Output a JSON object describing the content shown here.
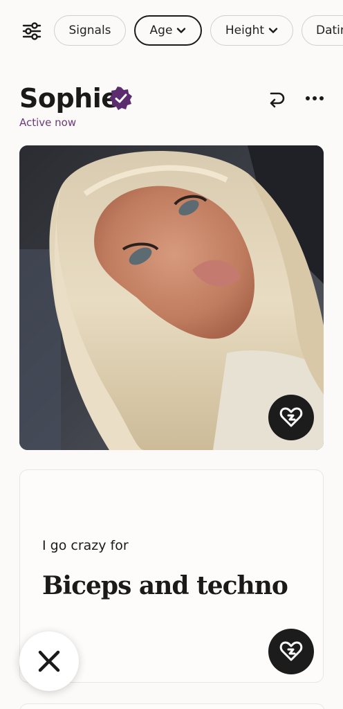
{
  "filters": {
    "chips": [
      {
        "label": "Signals",
        "dropdown": false,
        "active": false
      },
      {
        "label": "Age",
        "dropdown": true,
        "active": true
      },
      {
        "label": "Height",
        "dropdown": true,
        "active": false
      },
      {
        "label": "Dating",
        "dropdown": true,
        "active": false
      }
    ]
  },
  "profile": {
    "name": "Sophie",
    "status": "Active now",
    "verified_color": "#5b2d6e",
    "status_color": "#6b3a7a"
  },
  "prompt": {
    "question": "I go crazy for",
    "answer": "Biceps and techno"
  },
  "colors": {
    "background": "#fbfaf8",
    "like_button": "#1c1c1c",
    "text": "#1a1a1a"
  },
  "icons": {
    "filter": "sliders-icon",
    "verified": "verified-badge-icon",
    "undo": "undo-arrow-icon",
    "more": "more-dots-icon",
    "like": "heart-like-icon",
    "skip": "x-skip-icon"
  }
}
